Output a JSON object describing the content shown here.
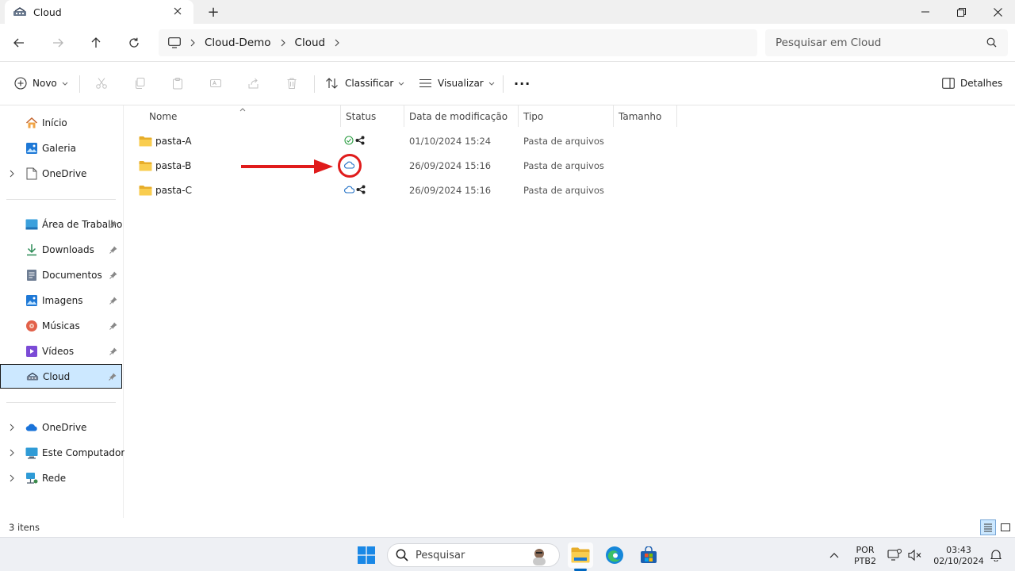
{
  "window": {
    "tab_title": "Cloud",
    "new_tab": "+"
  },
  "address": {
    "crumbs": [
      "Cloud-Demo",
      "Cloud"
    ],
    "search_placeholder": "Pesquisar em Cloud"
  },
  "commands": {
    "new_label": "Novo",
    "sort_label": "Classificar",
    "view_label": "Visualizar",
    "more_label": "...",
    "details_label": "Detalhes"
  },
  "sidebar": {
    "top": [
      {
        "label": "Início",
        "icon": "home-icon"
      },
      {
        "label": "Galeria",
        "icon": "gallery-icon"
      },
      {
        "label": "OneDrive",
        "icon": "onedrive-personal-icon"
      }
    ],
    "quick": [
      {
        "label": "Área de Trabalho",
        "icon": "desktop-icon"
      },
      {
        "label": "Downloads",
        "icon": "downloads-icon"
      },
      {
        "label": "Documentos",
        "icon": "documents-icon"
      },
      {
        "label": "Imagens",
        "icon": "pictures-icon"
      },
      {
        "label": "Músicas",
        "icon": "music-icon"
      },
      {
        "label": "Vídeos",
        "icon": "videos-icon"
      },
      {
        "label": "Cloud",
        "icon": "cloud-drive-icon"
      }
    ],
    "bottom": [
      {
        "label": "OneDrive",
        "icon": "onedrive-cloud-icon"
      },
      {
        "label": "Este Computador",
        "icon": "computer-icon"
      },
      {
        "label": "Rede",
        "icon": "network-icon"
      }
    ]
  },
  "columns": {
    "name": "Nome",
    "status": "Status",
    "modified": "Data de modificação",
    "type": "Tipo",
    "size": "Tamanho"
  },
  "files": [
    {
      "name": "pasta-A",
      "status": "available-shared",
      "modified": "01/10/2024 15:24",
      "type": "Pasta de arquivos"
    },
    {
      "name": "pasta-B",
      "status": "cloud-only",
      "modified": "26/09/2024 15:16",
      "type": "Pasta de arquivos"
    },
    {
      "name": "pasta-C",
      "status": "cloud-only-shared",
      "modified": "26/09/2024 15:16",
      "type": "Pasta de arquivos"
    }
  ],
  "statusbar": {
    "item_count": "3 itens"
  },
  "taskbar": {
    "search_placeholder": "Pesquisar",
    "lang_line1": "POR",
    "lang_line2": "PTB2",
    "time": "03:43",
    "date": "02/10/2024"
  },
  "colors": {
    "accent": "#0067c0",
    "selected_bg": "#cce8ff",
    "annotation_red": "#e01b1b",
    "folder_yellow": "#f4c445",
    "cloud_blue": "#1f6fc5",
    "sync_green": "#2e9e44"
  }
}
